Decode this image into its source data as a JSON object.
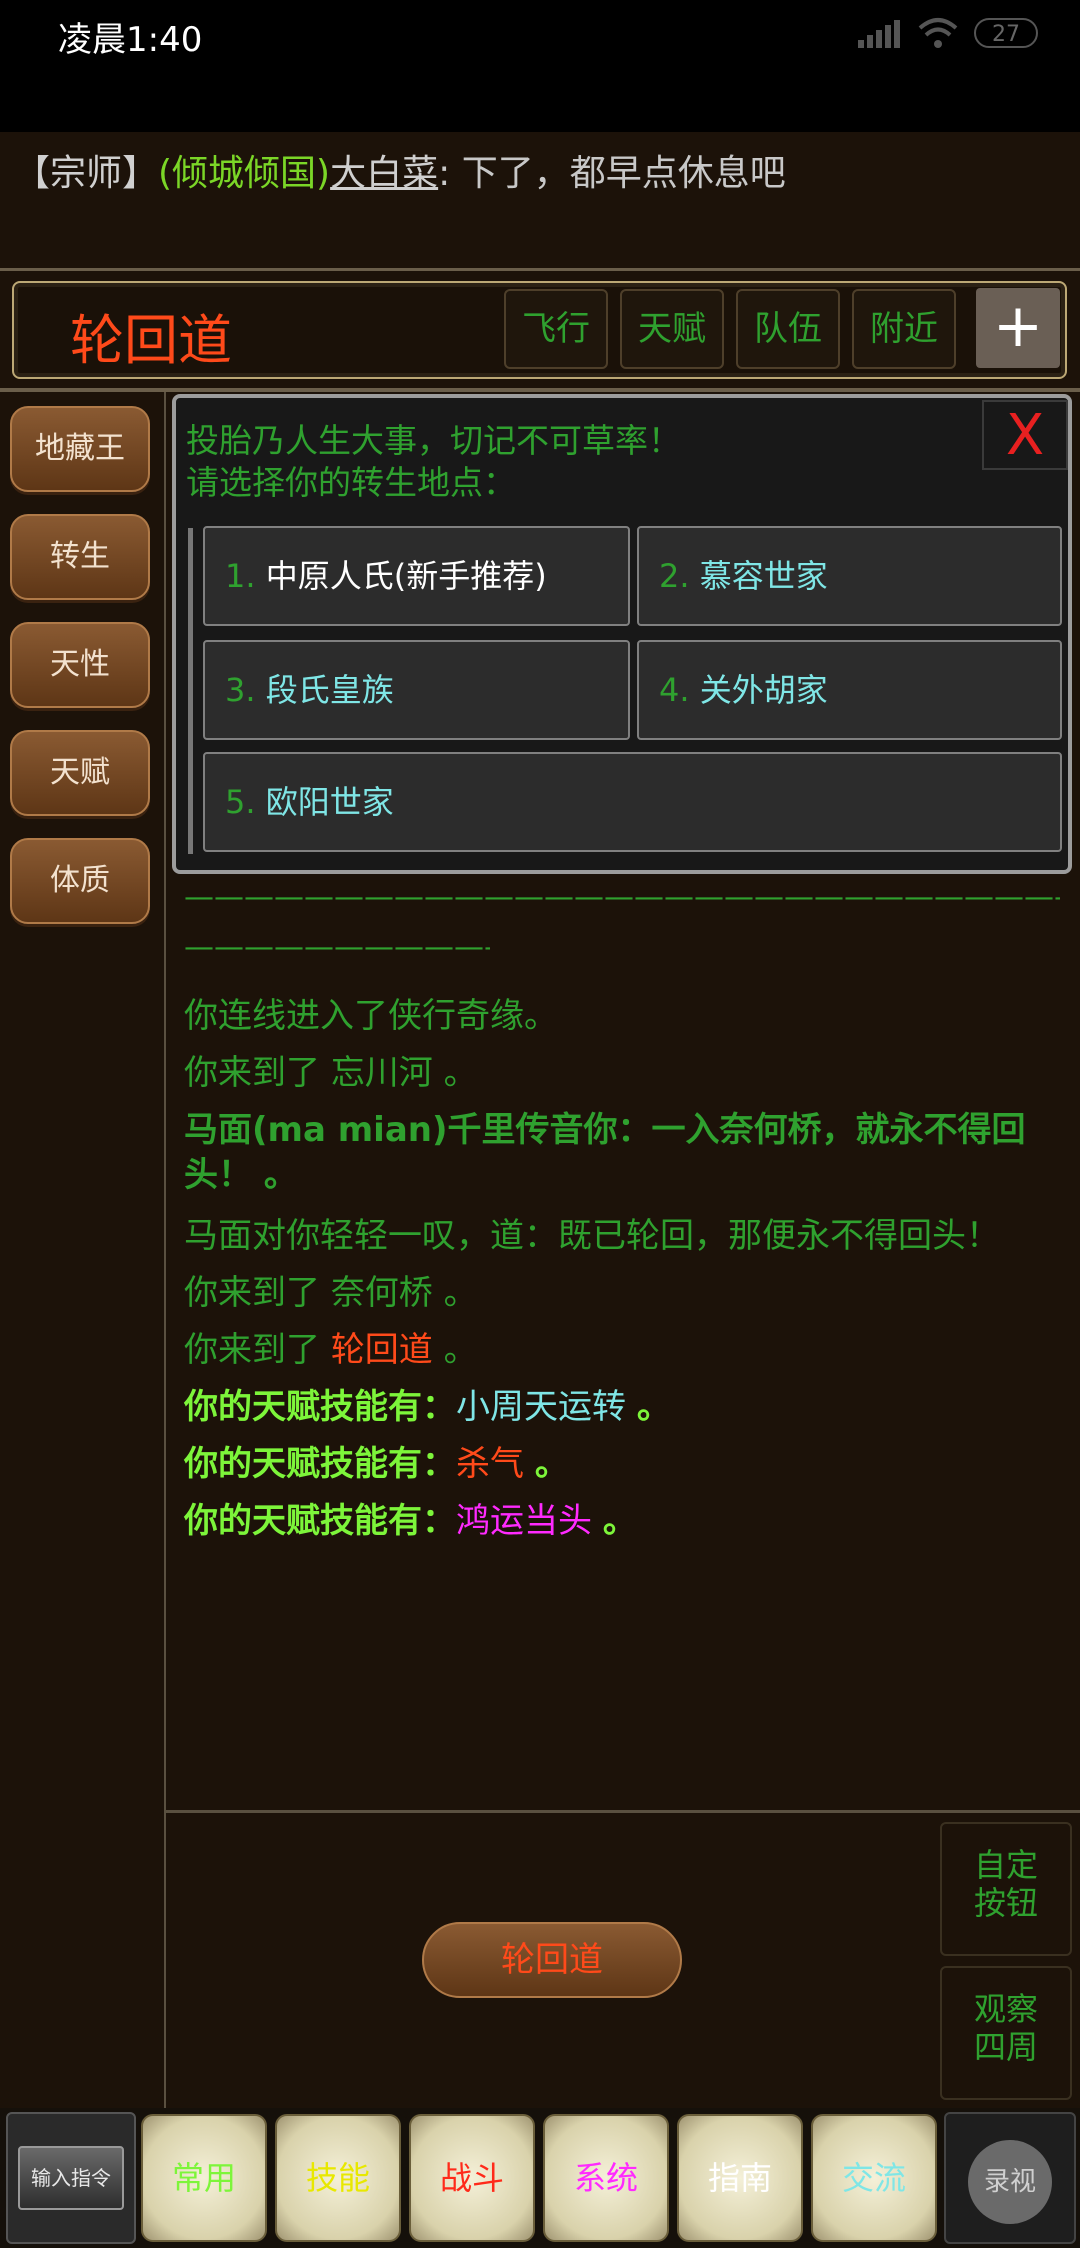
{
  "status_bar": {
    "time": "凌晨1:40",
    "battery": "27"
  },
  "announcement": {
    "rank": "【宗师】",
    "guild": "(倾城倾国)",
    "user": "大白菜",
    "message": ": 下了，都早点休息吧"
  },
  "location": {
    "title": "轮回道",
    "buttons": [
      "飞行",
      "天赋",
      "队伍",
      "附近"
    ],
    "add_label": "+"
  },
  "left_nav": [
    "地藏王",
    "转生",
    "天性",
    "天赋",
    "体质"
  ],
  "dialog": {
    "line1": "投胎乃人生大事，切记不可草率！",
    "line2": "请选择你的转生地点：",
    "close_label": "X",
    "options": [
      {
        "num": "1.",
        "label": "中原人氏(新手推荐)"
      },
      {
        "num": "2.",
        "label": "慕容世家"
      },
      {
        "num": "3.",
        "label": "段氏皇族"
      },
      {
        "num": "4.",
        "label": "关外胡家"
      },
      {
        "num": "5.",
        "label": "欧阳世家"
      }
    ]
  },
  "log": {
    "divider1": "——————————————————————————————————————————",
    "divider2": "——————————————",
    "line1": "你连线进入了侠行奇缘。",
    "line2_prefix": "你来到了",
    "line2_place": "忘川河",
    "line2_suffix": "。",
    "line3a": "马面(ma mian)千里传音你：一入奈何桥，就永不得回",
    "line3b": "头！ 。",
    "line4": "马面对你轻轻一叹，道：既已轮回，那便永不得回头！",
    "line5_prefix": "你来到了",
    "line5_place": "奈何桥",
    "line5_suffix": "。",
    "line6_prefix": "你来到了",
    "line6_place": "轮回道",
    "line6_suffix": "。",
    "talent_prefix": "你的天赋技能有：",
    "talent1": "小周天运转",
    "talent2": "杀气",
    "talent3": "鸿运当头",
    "period": "。"
  },
  "room_button": "轮回道",
  "side_buttons": [
    {
      "line1": "自定",
      "line2": "按钮"
    },
    {
      "line1": "观察",
      "line2": "四周"
    }
  ],
  "toolbar": {
    "input_label": "输入指令",
    "tabs": [
      {
        "label": "常用",
        "color": "#7df53a"
      },
      {
        "label": "技能",
        "color": "#e8e800"
      },
      {
        "label": "战斗",
        "color": "#ff2a1a"
      },
      {
        "label": "系统",
        "color": "#ff2aff"
      },
      {
        "label": "指南",
        "color": "#ffffff"
      },
      {
        "label": "交流",
        "color": "#7fe6e6"
      }
    ],
    "record_label": "录视"
  }
}
